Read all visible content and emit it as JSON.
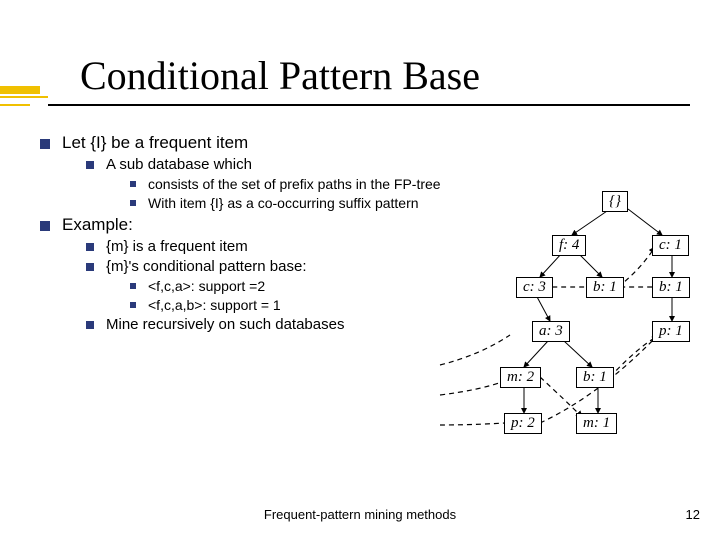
{
  "title": "Conditional Pattern Base",
  "bullets": {
    "let": "Let {I} be a frequent item",
    "subdb": "A sub database which",
    "consists": "consists of the set of prefix paths in the FP-tree",
    "withitem": "With item {I} as a co-occurring suffix pattern",
    "example": "Example:",
    "m_freq": "{m} is a frequent item",
    "m_cond": "{m}'s conditional pattern base:",
    "sup2": "<f,c,a>: support =2",
    "sup1": "<f,c,a,b>: support = 1",
    "mine": "Mine recursively on such databases"
  },
  "tree": {
    "root": "{}",
    "f4": "f: 4",
    "c1": "c: 1",
    "c3": "c: 3",
    "b1a": "b: 1",
    "b1b": "b: 1",
    "a3": "a: 3",
    "p1": "p: 1",
    "m2": "m: 2",
    "b1c": "b: 1",
    "p2": "p: 2",
    "m1": "m: 1"
  },
  "footer": "Frequent-pattern mining methods",
  "page": "12"
}
